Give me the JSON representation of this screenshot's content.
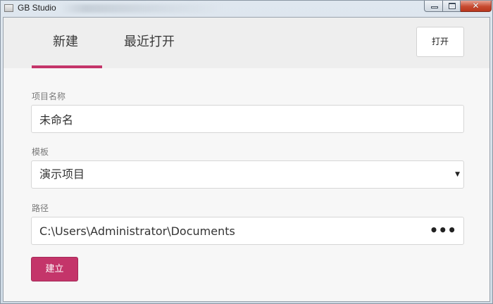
{
  "window": {
    "title": "GB Studio",
    "controls": {
      "close_glyph": "✕"
    }
  },
  "header": {
    "tabs": [
      {
        "label": "新建",
        "active": true
      },
      {
        "label": "最近打开",
        "active": false
      }
    ],
    "open_button": "打开"
  },
  "form": {
    "name_label": "项目名称",
    "name_value": "未命名",
    "template_label": "模板",
    "template_selected": "演示项目",
    "path_label": "路径",
    "path_value": "C:\\Users\\Administrator\\Documents",
    "browse_glyph": "•••",
    "select_arrow": "▼",
    "create_button": "建立"
  },
  "colors": {
    "accent": "#c4356a",
    "header_bg": "#eeeeee",
    "body_bg": "#f7f7f7"
  },
  "icons": [
    "app-icon",
    "minimize-icon",
    "maximize-icon",
    "close-icon",
    "dropdown-arrow-icon",
    "browse-dots-icon"
  ]
}
